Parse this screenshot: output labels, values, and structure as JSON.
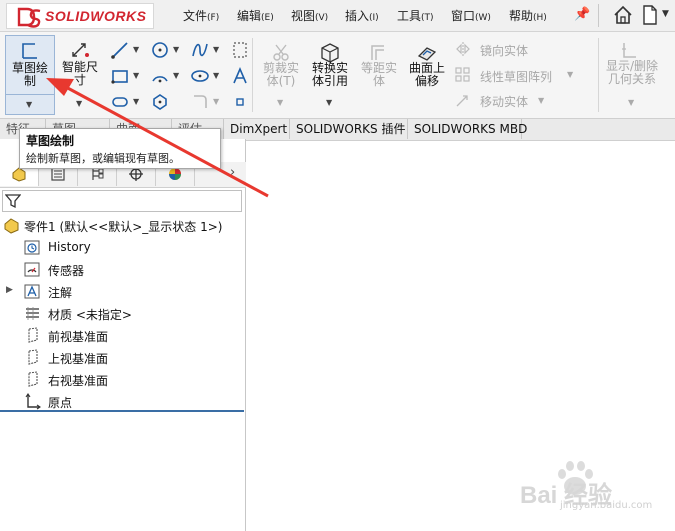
{
  "app": {
    "brand": "SOLIDWORKS",
    "brand_color": "#d22630"
  },
  "menu": {
    "items": [
      {
        "label": "文件",
        "accel": "(F)"
      },
      {
        "label": "编辑",
        "accel": "(E)"
      },
      {
        "label": "视图",
        "accel": "(V)"
      },
      {
        "label": "插入",
        "accel": "(I)"
      },
      {
        "label": "工具",
        "accel": "(T)"
      },
      {
        "label": "窗口",
        "accel": "(W)"
      },
      {
        "label": "帮助",
        "accel": "(H)"
      }
    ]
  },
  "ribbon": {
    "sketch": "草图绘\n制",
    "smart_dim": "智能尺\n寸",
    "trim": "剪裁实\n体(T)",
    "convert": "转换实\n体引用",
    "offset": "等距实\n体",
    "surface_offset": "曲面上\n偏移",
    "mirror": "镜向实体",
    "linear_pattern": "线性草图阵列",
    "move": "移动实体",
    "show_delete": "显示/删除\n几何关系"
  },
  "tabs": {
    "items": [
      "特征",
      "草图",
      "曲面",
      "评估",
      "DimXpert",
      "SOLIDWORKS 插件",
      "SOLIDWORKS MBD"
    ]
  },
  "tooltip": {
    "title": "草图绘制",
    "desc": "绘制新草图，或编辑现有草图。"
  },
  "tree": {
    "root": "零件1  (默认<<默认>_显示状态 1>)",
    "items": [
      {
        "label": "History",
        "icon": "history-icon"
      },
      {
        "label": "传感器",
        "icon": "sensor-icon"
      },
      {
        "label": "注解",
        "icon": "annotation-icon"
      },
      {
        "label": "材质 <未指定>",
        "icon": "material-icon"
      },
      {
        "label": "前视基准面",
        "icon": "plane-icon"
      },
      {
        "label": "上视基准面",
        "icon": "plane-icon"
      },
      {
        "label": "右视基准面",
        "icon": "plane-icon"
      },
      {
        "label": "原点",
        "icon": "origin-icon"
      }
    ]
  },
  "watermark": {
    "text": "Bai 经验",
    "url": "jingyan.baidu.com"
  },
  "colors": {
    "arrow": "#e8382f",
    "accent": "#1f5fa8"
  }
}
